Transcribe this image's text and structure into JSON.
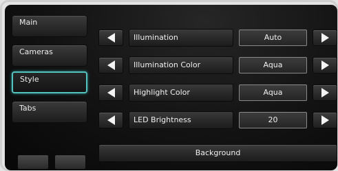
{
  "sidebar": {
    "items": [
      {
        "label": "Main",
        "active": false
      },
      {
        "label": "Cameras",
        "active": false
      },
      {
        "label": "Style",
        "active": true
      },
      {
        "label": "Tabs",
        "active": false
      }
    ],
    "accent_color": "#54c3c0"
  },
  "settings": {
    "rows": [
      {
        "label": "Illumination",
        "value": "Auto"
      },
      {
        "label": "Illumination Color",
        "value": "Aqua"
      },
      {
        "label": "Highlight Color",
        "value": "Aqua"
      },
      {
        "label": "LED Brightness",
        "value": "20"
      }
    ]
  },
  "background_button": {
    "label": "Background"
  },
  "icons": {
    "decrement": "left-arrow-icon",
    "increment": "right-arrow-icon"
  }
}
